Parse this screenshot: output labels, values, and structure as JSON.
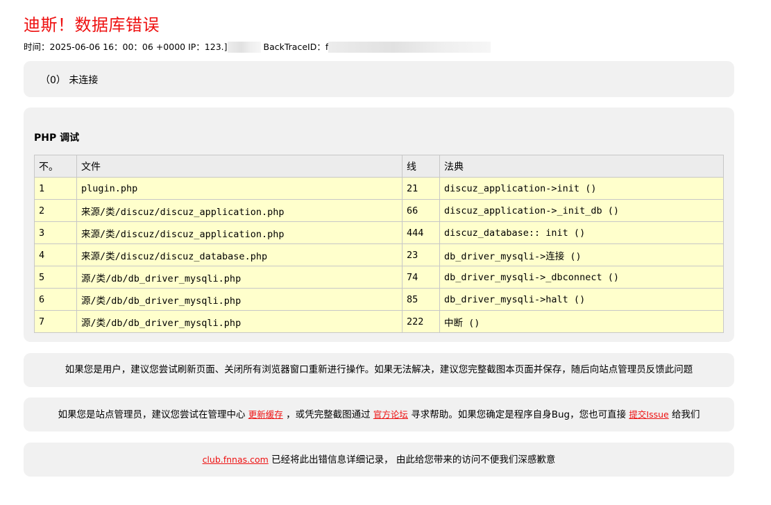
{
  "page": {
    "title": "迪斯！数据库错误",
    "meta_time": "时间：2025-06-06 16：00：06 +0000 IP：123.",
    "meta_ip_end": "]",
    "meta_trace_label": "BackTraceID：f"
  },
  "error": {
    "message": "（0） 未连接"
  },
  "debug": {
    "heading": "PHP 调试",
    "columns": [
      "不。",
      "文件",
      "线",
      "法典"
    ],
    "rows": [
      {
        "no": "1",
        "file": "plugin.php",
        "line": "21",
        "code": "discuz_application->init ()"
      },
      {
        "no": "2",
        "file": "来源/类/discuz/discuz_application.php",
        "line": "66",
        "code": "discuz_application->_init_db ()"
      },
      {
        "no": "3",
        "file": "来源/类/discuz/discuz_application.php",
        "line": "444",
        "code": "discuz_database:: init ()"
      },
      {
        "no": "4",
        "file": "来源/类/discuz/discuz_database.php",
        "line": "23",
        "code": "db_driver_mysqli->连接 ()"
      },
      {
        "no": "5",
        "file": "源/类/db/db_driver_mysqli.php",
        "line": "74",
        "code": "db_driver_mysqli->_dbconnect ()"
      },
      {
        "no": "6",
        "file": "源/类/db/db_driver_mysqli.php",
        "line": "85",
        "code": "db_driver_mysqli->halt ()"
      },
      {
        "no": "7",
        "file": "源/类/db/db_driver_mysqli.php",
        "line": "222",
        "code": "中断 ()"
      }
    ]
  },
  "notes": {
    "user": "如果您是用户，建议您尝试刷新页面、关闭所有浏览器窗口重新进行操作。如果无法解决，建议您完整截图本页面并保存，随后向站点管理员反馈此问题",
    "admin_part1": "如果您是站点管理员，建议您尝试在管理中心 ",
    "admin_link_cache": "更新缓存",
    "admin_part2": " ，或凭完整截图通过 ",
    "admin_link_forum": "官方论坛",
    "admin_part3": " 寻求帮助。如果您确定是程序自身Bug，您也可直接 ",
    "admin_link_issue": "提交Issue",
    "admin_part4": " 给我们",
    "site_link": "club.fnnas.com",
    "site_text": " 已经将此出错信息详细记录， 由此给您带来的访问不便我们深感歉意"
  }
}
